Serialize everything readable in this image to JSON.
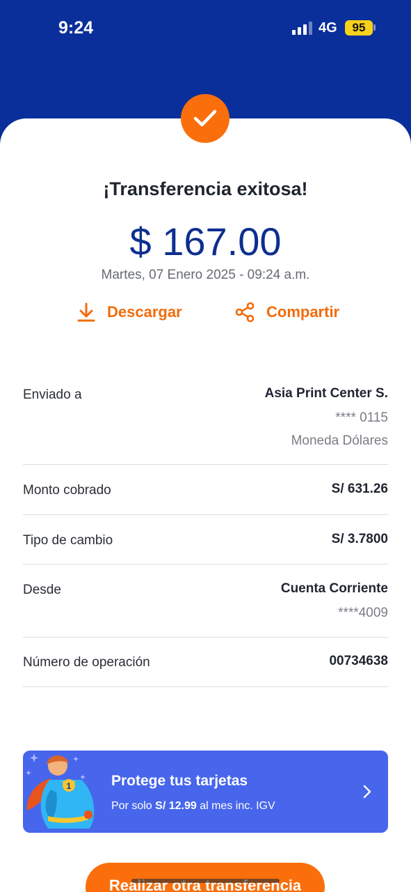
{
  "status_bar": {
    "time": "9:24",
    "network": "4G",
    "battery": "95"
  },
  "result": {
    "title": "¡Transferencia exitosa!",
    "amount": "$ 167.00",
    "datetime": "Martes, 07 Enero 2025 - 09:24 a.m."
  },
  "actions": {
    "download_label": "Descargar",
    "share_label": "Compartir"
  },
  "details": {
    "sent_to": {
      "label": "Enviado a",
      "name": "Asia Print Center S.",
      "account": "**** 0115",
      "currency": "Moneda Dólares"
    },
    "amount_charged": {
      "label": "Monto cobrado",
      "value": "S/ 631.26"
    },
    "exchange_rate": {
      "label": "Tipo de cambio",
      "value": "S/ 3.7800"
    },
    "from": {
      "label": "Desde",
      "account_type": "Cuenta Corriente",
      "account_number": "****4009"
    },
    "operation_number": {
      "label": "Número de operación",
      "value": "00734638"
    }
  },
  "promo": {
    "title": "Protege tus tarjetas",
    "sub_prefix": "Por solo ",
    "sub_price": "S/ 12.99",
    "sub_suffix": " al mes inc. IGV"
  },
  "cta": {
    "label": "Realizar otra transferencia"
  },
  "colors": {
    "header_blue": "#0a2f9a",
    "accent_orange": "#fa6f0c",
    "amount_blue": "#0d2f8f",
    "promo_blue": "#4766ec"
  },
  "icons": {
    "check": "check-icon",
    "download": "download-icon",
    "share": "share-icon",
    "chevron": "chevron-right-icon"
  }
}
